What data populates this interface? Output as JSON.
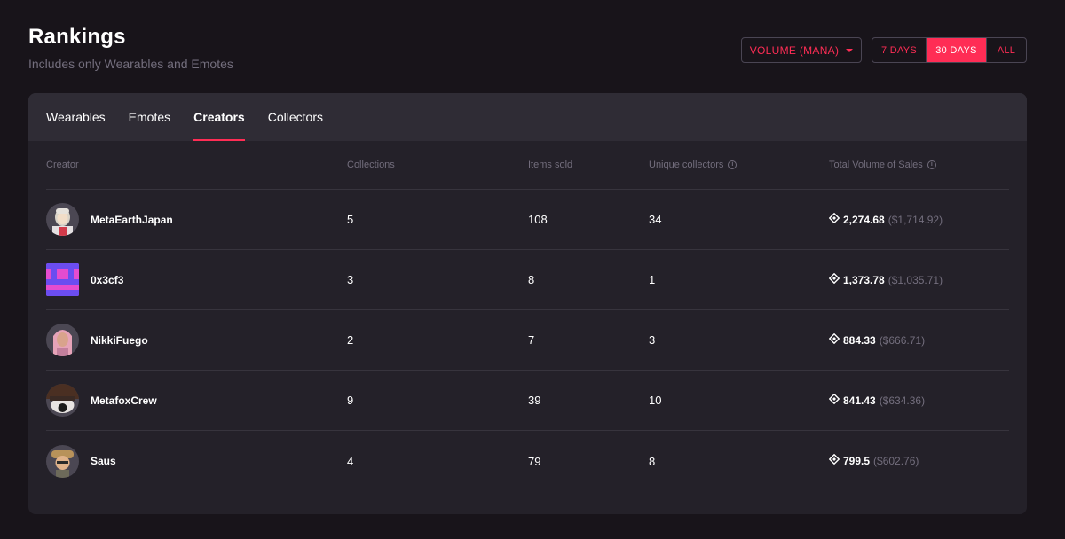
{
  "header": {
    "title": "Rankings",
    "subtitle": "Includes only Wearables and Emotes"
  },
  "controls": {
    "metric_label": "VOLUME (MANA)",
    "ranges": [
      "7 DAYS",
      "30 DAYS",
      "ALL"
    ],
    "active_range": "30 DAYS"
  },
  "tabs": [
    {
      "label": "Wearables",
      "active": false
    },
    {
      "label": "Emotes",
      "active": false
    },
    {
      "label": "Creators",
      "active": true
    },
    {
      "label": "Collectors",
      "active": false
    }
  ],
  "table": {
    "headers": {
      "creator": "Creator",
      "collections": "Collections",
      "items_sold": "Items sold",
      "unique_collectors": "Unique collectors",
      "total_volume": "Total Volume of Sales"
    },
    "rows": [
      {
        "name": "MetaEarthJapan",
        "collections": "5",
        "items_sold": "108",
        "unique_collectors": "34",
        "volume": "2,274.68",
        "usd": "($1,714.92)",
        "avatar_icon": "avatar-icon"
      },
      {
        "name": "0x3cf3",
        "collections": "3",
        "items_sold": "8",
        "unique_collectors": "1",
        "volume": "1,373.78",
        "usd": "($1,035.71)",
        "avatar_icon": "pixel-avatar-icon"
      },
      {
        "name": "NikkiFuego",
        "collections": "2",
        "items_sold": "7",
        "unique_collectors": "3",
        "volume": "884.33",
        "usd": "($666.71)",
        "avatar_icon": "avatar-icon"
      },
      {
        "name": "MetafoxCrew",
        "collections": "9",
        "items_sold": "39",
        "unique_collectors": "10",
        "volume": "841.43",
        "usd": "($634.36)",
        "avatar_icon": "avatar-icon"
      },
      {
        "name": "Saus",
        "collections": "4",
        "items_sold": "79",
        "unique_collectors": "8",
        "volume": "799.5",
        "usd": "($602.76)",
        "avatar_icon": "avatar-icon"
      }
    ]
  },
  "colors": {
    "accent": "#ff2d55",
    "background": "#18141a",
    "panel": "#242129",
    "muted_text": "#736e7d"
  }
}
